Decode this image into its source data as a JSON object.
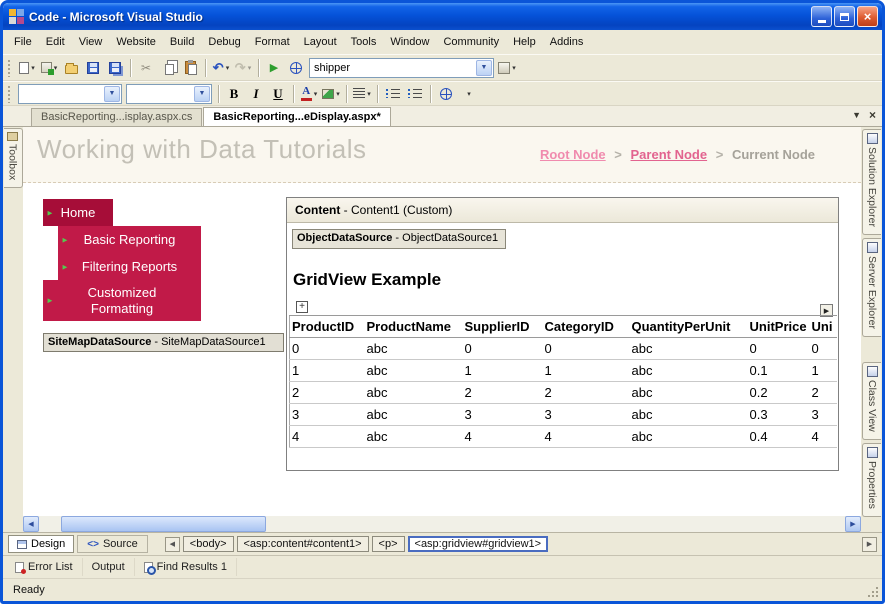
{
  "window": {
    "title": "Code - Microsoft Visual Studio"
  },
  "icons": {
    "dropdown": "▾",
    "menu_arrow": "▼",
    "close": "×",
    "scissors": "✂",
    "undo": "↶",
    "redo": "↷",
    "play": "▶",
    "left_arrow": "◀",
    "right_arrow": "▶",
    "up_arrow": "▲",
    "green_arrow": "►",
    "plus": "+",
    "smart_tag_arrow": "▶",
    "source_markup": "<>"
  },
  "menubar": {
    "items": [
      "File",
      "Edit",
      "View",
      "Website",
      "Build",
      "Debug",
      "Format",
      "Layout",
      "Tools",
      "Window",
      "Community",
      "Help",
      "Addins"
    ]
  },
  "standard_toolbar": {
    "object_combo": "shipper"
  },
  "format_toolbar": {
    "font_name": "",
    "font_size": "",
    "bold": "B",
    "italic": "I",
    "underline": "U",
    "font_color": "A"
  },
  "doc_tabs": {
    "tab1": "BasicReporting...isplay.aspx.cs",
    "tab2": "BasicReporting...eDisplay.aspx*"
  },
  "left_dock": {
    "toolbox": "Toolbox"
  },
  "right_dock": {
    "tabs": [
      "Solution Explorer",
      "Server Explorer",
      "Class View",
      "Properties"
    ]
  },
  "designer": {
    "page_title": "Working with Data Tutorials",
    "breadcrumb": {
      "root": "Root Node",
      "sep": ">",
      "parent": "Parent Node",
      "current": "Current Node"
    },
    "nav_menu": {
      "items": [
        "Home",
        "Basic Reporting",
        "Filtering Reports",
        "Customized Formatting"
      ]
    },
    "sitemap_datasource": {
      "bold": "SiteMapDataSource",
      "rest": " - SiteMapDataSource1"
    },
    "content_panel": {
      "bold": "Content",
      "rest": " - Content1 (Custom)"
    },
    "object_datasource": {
      "bold": "ObjectDataSource",
      "rest": " - ObjectDataSource1"
    },
    "gridview_title": "GridView Example",
    "grid": {
      "columns": [
        "ProductID",
        "ProductName",
        "SupplierID",
        "CategoryID",
        "QuantityPerUnit",
        "UnitPrice",
        "Uni"
      ],
      "rows": [
        [
          "0",
          "abc",
          "0",
          "0",
          "abc",
          "0",
          "0"
        ],
        [
          "1",
          "abc",
          "1",
          "1",
          "abc",
          "0.1",
          "1"
        ],
        [
          "2",
          "abc",
          "2",
          "2",
          "abc",
          "0.2",
          "2"
        ],
        [
          "3",
          "abc",
          "3",
          "3",
          "abc",
          "0.3",
          "3"
        ],
        [
          "4",
          "abc",
          "4",
          "4",
          "abc",
          "0.4",
          "4"
        ]
      ]
    }
  },
  "bottom_bar": {
    "design": "Design",
    "source": "Source",
    "tags": [
      "<body>",
      "<asp:content#content1>",
      "<p>",
      "<asp:gridview#gridview1>"
    ]
  },
  "panel_tabs": {
    "items": [
      "Error List",
      "Output",
      "Find Results 1"
    ]
  },
  "statusbar": {
    "text": "Ready"
  },
  "colors": {
    "titlebar_blue": "#0552d8",
    "nav_red": "#c11a48",
    "nav_red_dark": "#a60d38",
    "breadcrumb_pink": "#ef7fa7",
    "page_title_gray": "#c3c0b7"
  }
}
